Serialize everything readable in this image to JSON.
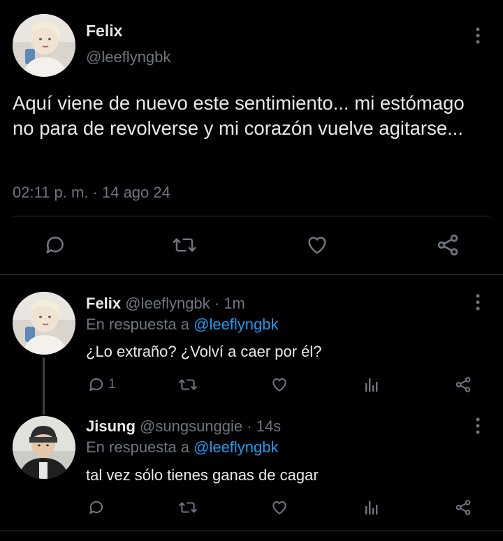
{
  "main_tweet": {
    "author_name": "Felix",
    "handle": "@leeflyngbk",
    "text": "Aquí viene de nuevo este sentimiento... mi estómago no para de revolverse y mi corazón vuelve agitarse...",
    "timestamp": "02:11 p. m. · 14 ago 24",
    "actions": [
      "reply-icon",
      "retweet-icon",
      "like-icon",
      "share-icon"
    ]
  },
  "replies": [
    {
      "author_name": "Felix",
      "handle": "@leeflyngbk",
      "time": "· 1m",
      "reply_prefix": "En respuesta a",
      "reply_to": "@leeflyngbk",
      "text": "¿Lo extraño? ¿Volví a caer por él?",
      "reply_count": "1"
    },
    {
      "author_name": "Jisung",
      "handle": "@sungsunggie",
      "time": "· 14s",
      "reply_prefix": "En respuesta a",
      "reply_to": "@leeflyngbk",
      "text": "tal vez sólo tienes ganas de cagar",
      "reply_count": ""
    }
  ],
  "colors": {
    "background": "#000000",
    "text": "#e7e9ea",
    "muted": "#6e767d",
    "link": "#1d9bf0",
    "divider": "#2f3336"
  }
}
